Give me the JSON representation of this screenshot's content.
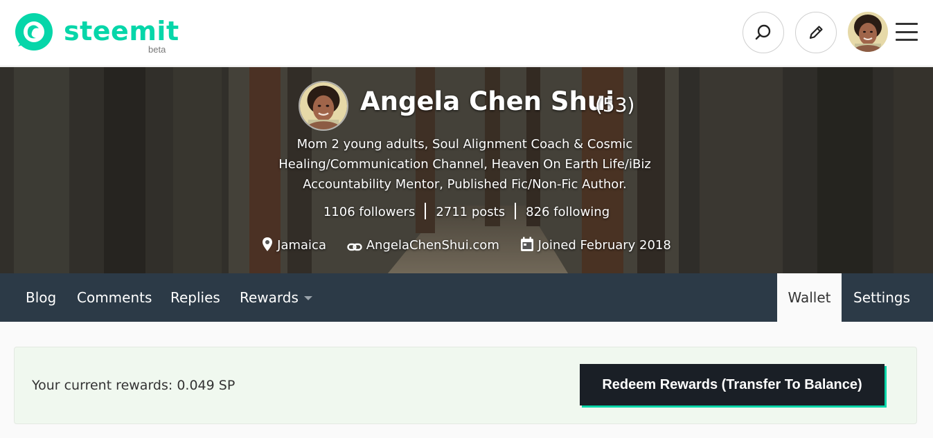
{
  "brand": {
    "name": "steemit",
    "badge": "beta",
    "accent_color": "#06d6a9"
  },
  "header_actions": {
    "search_icon": "search-icon",
    "edit_icon": "pencil-icon",
    "menu_icon": "hamburger-icon"
  },
  "profile": {
    "name": "Angela Chen Shui",
    "reputation": "(53)",
    "about": "Mom 2 young adults, Soul Alignment Coach & Cosmic Healing/Communication Channel, Heaven On Earth Life/iBiz Accountability Mentor, Published Fic/Non-Fic Author.",
    "stats": {
      "followers": "1106 followers",
      "posts": "2711 posts",
      "following": "826 following"
    },
    "location": "Jamaica",
    "website": "AngelaChenShui.com",
    "joined": "Joined February 2018"
  },
  "tabs": {
    "blog": "Blog",
    "comments": "Comments",
    "replies": "Replies",
    "rewards": "Rewards",
    "wallet": "Wallet",
    "settings": "Settings",
    "active": "Wallet"
  },
  "rewards": {
    "current_label": "Your current rewards: 0.049 SP",
    "redeem_button": "Redeem Rewards (Transfer To Balance)"
  }
}
